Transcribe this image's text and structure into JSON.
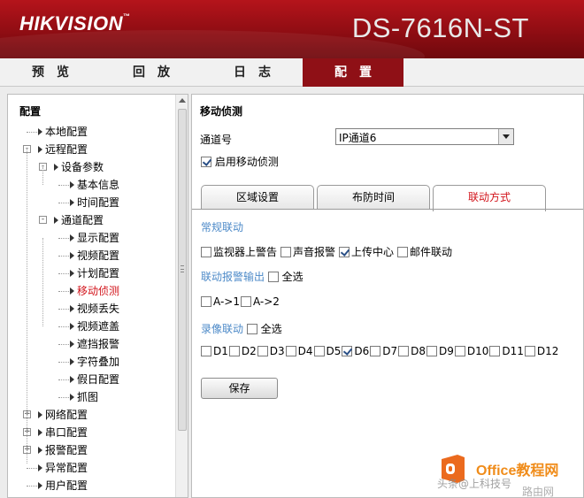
{
  "header": {
    "logo": "HIKVISION",
    "logo_tm": "™",
    "model": "DS-7616N-ST"
  },
  "nav": {
    "tabs": [
      {
        "label": "预览"
      },
      {
        "label": "回放"
      },
      {
        "label": "日志"
      },
      {
        "label": "配置",
        "active": true
      }
    ]
  },
  "sidebar": {
    "title": "配置",
    "items": [
      {
        "label": "本地配置"
      },
      {
        "label": "远程配置"
      },
      {
        "label": "设备参数"
      },
      {
        "label": "基本信息"
      },
      {
        "label": "时间配置"
      },
      {
        "label": "通道配置"
      },
      {
        "label": "显示配置"
      },
      {
        "label": "视频配置"
      },
      {
        "label": "计划配置"
      },
      {
        "label": "移动侦测",
        "selected": true
      },
      {
        "label": "视频丢失"
      },
      {
        "label": "视频遮盖"
      },
      {
        "label": "遮挡报警"
      },
      {
        "label": "字符叠加"
      },
      {
        "label": "假日配置"
      },
      {
        "label": "抓图"
      },
      {
        "label": "网络配置"
      },
      {
        "label": "串口配置"
      },
      {
        "label": "报警配置"
      },
      {
        "label": "异常配置"
      },
      {
        "label": "用户配置"
      }
    ]
  },
  "main": {
    "title": "移动侦测",
    "channel_label": "通道号",
    "channel_value": "IP通道6",
    "enable_label": "启用移动侦测",
    "enable_checked": true,
    "tabs": [
      {
        "label": "区域设置"
      },
      {
        "label": "布防时间"
      },
      {
        "label": "联动方式",
        "active": true
      }
    ],
    "normal_linkage": {
      "title": "常规联动",
      "items": [
        {
          "label": "监视器上警告",
          "checked": false
        },
        {
          "label": "声音报警",
          "checked": false
        },
        {
          "label": "上传中心",
          "checked": true
        },
        {
          "label": "邮件联动",
          "checked": false
        }
      ]
    },
    "alarm_output": {
      "title": "联动报警输出",
      "select_all": "全选",
      "items": [
        {
          "label": "A->1",
          "checked": false
        },
        {
          "label": "A->2",
          "checked": false
        }
      ]
    },
    "record_linkage": {
      "title": "录像联动",
      "select_all": "全选",
      "items": [
        {
          "label": "D1",
          "checked": false
        },
        {
          "label": "D2",
          "checked": false
        },
        {
          "label": "D3",
          "checked": false
        },
        {
          "label": "D4",
          "checked": false
        },
        {
          "label": "D5",
          "checked": false
        },
        {
          "label": "D6",
          "checked": true
        },
        {
          "label": "D7",
          "checked": false
        },
        {
          "label": "D8",
          "checked": false
        },
        {
          "label": "D9",
          "checked": false
        },
        {
          "label": "D10",
          "checked": false
        },
        {
          "label": "D11",
          "checked": false
        },
        {
          "label": "D12",
          "checked": false
        }
      ]
    },
    "save_label": "保存"
  },
  "watermark": {
    "site": "Office教程网",
    "caption": "头条@上科技号",
    "sub": "路由网"
  },
  "colors": {
    "brand": "#8f1016",
    "active_tab_text": "#d2141b",
    "section_title": "#4d8ac8",
    "watermark": "#f08c1a"
  }
}
